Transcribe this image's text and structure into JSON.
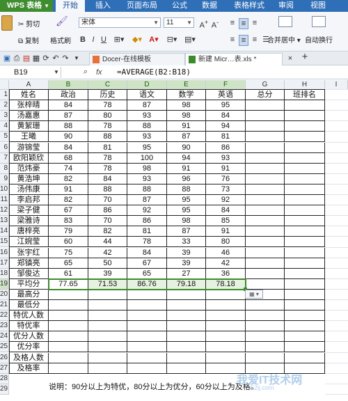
{
  "app": {
    "title": "WPS 表格"
  },
  "menu": [
    "开始",
    "插入",
    "页面布局",
    "公式",
    "数据",
    "表格样式",
    "审阅",
    "视图"
  ],
  "ribbon": {
    "cut": "剪切",
    "copy": "复制",
    "format_painter": "格式刷",
    "font_name": "宋体",
    "font_size": "11",
    "merge_center": "合并居中",
    "wrap_text": "自动换行"
  },
  "tabs": [
    "Docer-在线模板",
    "新建 Micr…表.xls *"
  ],
  "formula_bar": {
    "cell_ref": "B19",
    "fx": "fx",
    "formula": "=AVERAGE(B2:B18)"
  },
  "columns": [
    "A",
    "B",
    "C",
    "D",
    "E",
    "F",
    "G",
    "H",
    "I"
  ],
  "rows": [
    "1",
    "2",
    "3",
    "4",
    "5",
    "6",
    "7",
    "8",
    "9",
    "10",
    "11",
    "12",
    "13",
    "14",
    "15",
    "16",
    "17",
    "18",
    "19",
    "20",
    "21",
    "22",
    "23",
    "24",
    "25",
    "26",
    "27",
    "28",
    "29"
  ],
  "headers": [
    "姓名",
    "政治",
    "历史",
    "语文",
    "数学",
    "英语",
    "总分",
    "班排名"
  ],
  "students": [
    {
      "name": "张梓晴",
      "scores": [
        "84",
        "78",
        "87",
        "98",
        "95"
      ]
    },
    {
      "name": "汤嘉惠",
      "scores": [
        "87",
        "80",
        "93",
        "98",
        "84"
      ]
    },
    {
      "name": "黄絮珊",
      "scores": [
        "88",
        "78",
        "88",
        "91",
        "94"
      ]
    },
    {
      "name": "王曦",
      "scores": [
        "90",
        "88",
        "93",
        "87",
        "81"
      ]
    },
    {
      "name": "游锦莹",
      "scores": [
        "84",
        "81",
        "95",
        "90",
        "86"
      ]
    },
    {
      "name": "欧阳颖欣",
      "scores": [
        "68",
        "78",
        "100",
        "94",
        "93"
      ]
    },
    {
      "name": "范炜豪",
      "scores": [
        "74",
        "78",
        "98",
        "91",
        "91"
      ]
    },
    {
      "name": "黄浩坤",
      "scores": [
        "82",
        "84",
        "93",
        "96",
        "76"
      ]
    },
    {
      "name": "汤伟康",
      "scores": [
        "91",
        "88",
        "88",
        "88",
        "73"
      ]
    },
    {
      "name": "李启邦",
      "scores": [
        "82",
        "70",
        "87",
        "95",
        "92"
      ]
    },
    {
      "name": "梁子健",
      "scores": [
        "67",
        "86",
        "92",
        "95",
        "84"
      ]
    },
    {
      "name": "梁雅诗",
      "scores": [
        "83",
        "70",
        "86",
        "98",
        "85"
      ]
    },
    {
      "name": "唐梓亮",
      "scores": [
        "79",
        "82",
        "81",
        "87",
        "91"
      ]
    },
    {
      "name": "江婉莹",
      "scores": [
        "60",
        "44",
        "78",
        "33",
        "80"
      ]
    },
    {
      "name": "张宇红",
      "scores": [
        "75",
        "42",
        "84",
        "39",
        "46"
      ]
    },
    {
      "name": "郑镇亮",
      "scores": [
        "65",
        "50",
        "67",
        "39",
        "42"
      ]
    },
    {
      "name": "邹俊达",
      "scores": [
        "61",
        "39",
        "65",
        "27",
        "36"
      ]
    }
  ],
  "average": {
    "label": "平均分",
    "values": [
      "77.65",
      "71.53",
      "86.76",
      "79.18",
      "78.18"
    ]
  },
  "stat_labels": [
    "最高分",
    "最低分",
    "特优人数",
    "特优率",
    "优分人数",
    "优分率",
    "及格人数",
    "及格率"
  ],
  "note": "说明：90分以上为特优，80分以上为优分，60分以上为及格。",
  "watermark": {
    "main": "我爱IT技术网",
    "sub": "52ij.com"
  },
  "colors": {
    "accent_green": "#3c8a2a",
    "menubar_blue": "#2f6fb8"
  }
}
